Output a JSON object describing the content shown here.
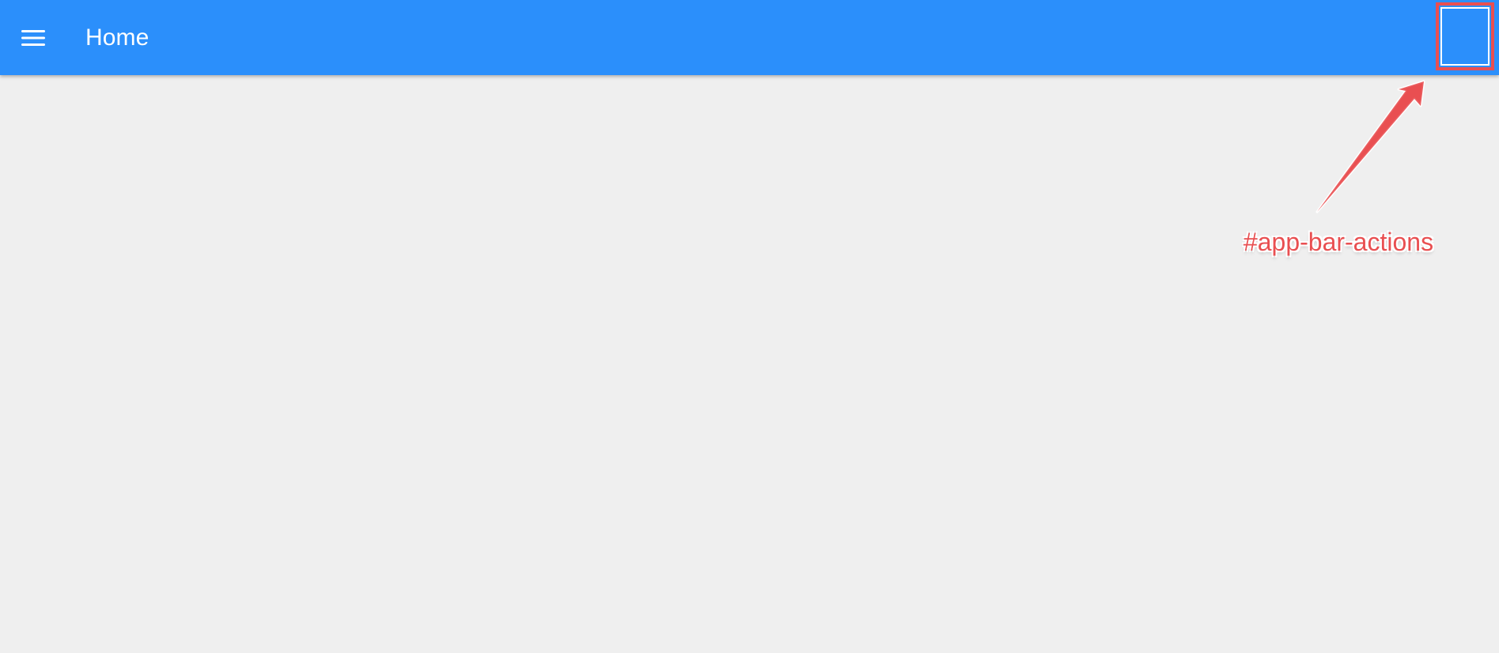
{
  "app_bar": {
    "title": "Home",
    "menu_icon": "hamburger-menu-icon",
    "background_color": "#2b8ffb",
    "title_color": "#ffffff"
  },
  "annotation": {
    "label": "#app-bar-actions",
    "color": "#e94f51",
    "outline_color": "#ffffff",
    "icon": "arrow-icon"
  },
  "page": {
    "background_color": "#efefef"
  }
}
